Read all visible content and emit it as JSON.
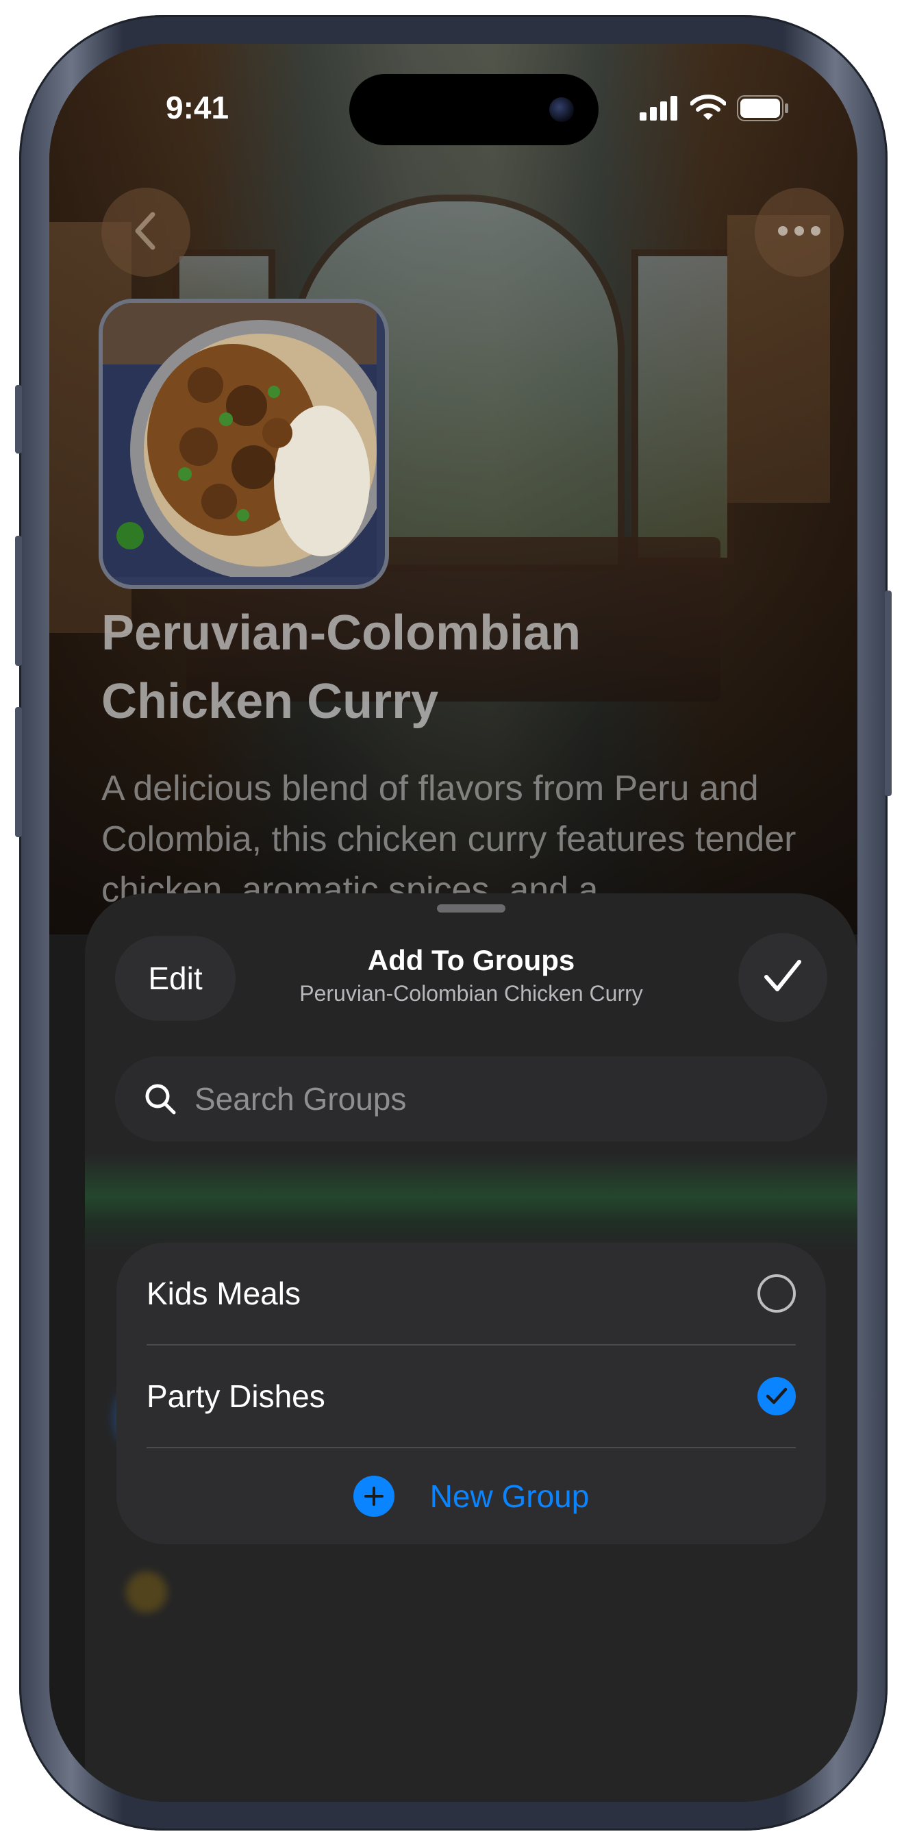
{
  "status_bar": {
    "time": "9:41",
    "signal_icon": "cellular-signal-icon",
    "wifi_icon": "wifi-icon",
    "battery_icon": "battery-icon"
  },
  "nav": {
    "back_icon": "chevron-left-icon",
    "more_icon": "ellipsis-icon"
  },
  "recipe": {
    "title_line1": "Peruvian-Colombian",
    "title_line2": "Chicken Curry",
    "description": "A delicious blend of flavors from Peru and Colombia, this chicken curry features tender chicken, aromatic spices, and a"
  },
  "sheet": {
    "edit_label": "Edit",
    "title": "Add To Groups",
    "subtitle": "Peruvian-Colombian Chicken Curry",
    "done_icon": "checkmark-icon",
    "search": {
      "placeholder": "Search Groups",
      "value": ""
    },
    "groups": [
      {
        "label": "Kids Meals",
        "selected": false
      },
      {
        "label": "Party Dishes",
        "selected": true
      }
    ],
    "new_group_label": "New Group"
  },
  "colors": {
    "accent": "#0a84ff",
    "sheet_bg": "#252526",
    "card_bg": "#2d2d2f"
  }
}
